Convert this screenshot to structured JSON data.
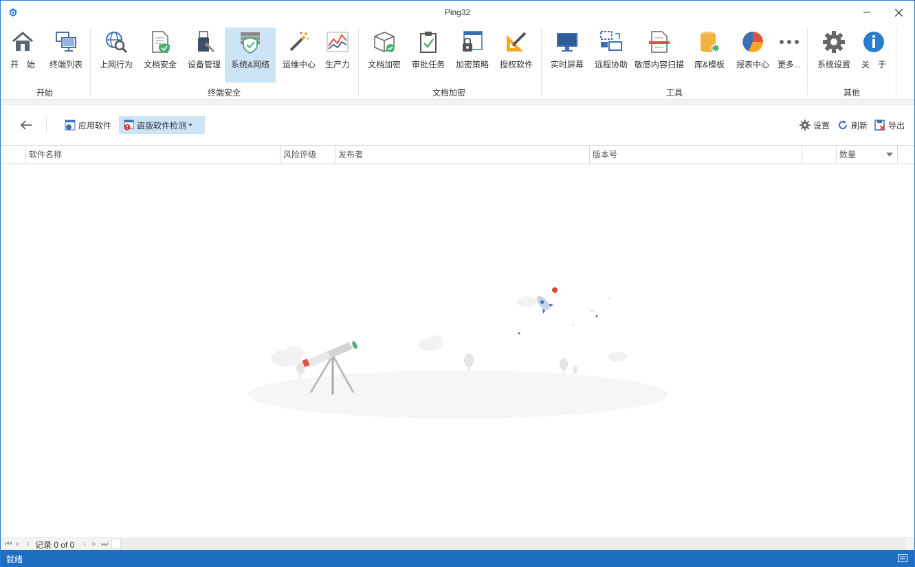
{
  "window": {
    "title": "Ping32"
  },
  "ribbon": {
    "buttons": [
      {
        "label": "开　始",
        "icon": "home-icon"
      },
      {
        "label": "终端列表",
        "icon": "terminal-list-icon"
      },
      {
        "label": "上网行为",
        "icon": "web-search-icon"
      },
      {
        "label": "文档安全",
        "icon": "document-shield-icon"
      },
      {
        "label": "设备管理",
        "icon": "usb-device-icon"
      },
      {
        "label": "系统&网络",
        "icon": "firewall-shield-icon"
      },
      {
        "label": "运维中心",
        "icon": "magic-wand-icon"
      },
      {
        "label": "生产力",
        "icon": "productivity-chart-icon"
      },
      {
        "label": "文档加密",
        "icon": "box-encrypt-icon"
      },
      {
        "label": "审批任务",
        "icon": "clipboard-check-icon"
      },
      {
        "label": "加密策略",
        "icon": "lock-window-icon"
      },
      {
        "label": "授权软件",
        "icon": "ruler-pencil-icon"
      },
      {
        "label": "实时屏幕",
        "icon": "monitor-icon"
      },
      {
        "label": "远程协助",
        "icon": "remote-desktop-icon"
      },
      {
        "label": "敏感内容扫描",
        "icon": "document-scan-icon"
      },
      {
        "label": "库&模板",
        "icon": "database-icon"
      },
      {
        "label": "报表中心",
        "icon": "pie-chart-icon"
      },
      {
        "label": "更多...",
        "icon": "more-dots-icon"
      },
      {
        "label": "系统设置",
        "icon": "gear-icon"
      },
      {
        "label": "关　于",
        "icon": "info-icon"
      }
    ],
    "groups": [
      "开始",
      "终端安全",
      "文档加密",
      "工具",
      "其他"
    ],
    "active": "系统&网络"
  },
  "toolbar": {
    "back_label": "",
    "app_software": "应用软件",
    "pirated_detect": "盗版软件检测",
    "settings": "设置",
    "refresh": "刷新",
    "export": "导出"
  },
  "grid": {
    "columns": [
      "软件名称",
      "风险评级",
      "发布者",
      "版本号",
      "",
      "数量"
    ],
    "rows": []
  },
  "pager": {
    "records": "记录 0 of 0"
  },
  "status": {
    "text": "就绪"
  },
  "colors": {
    "accent": "#1e6fc4",
    "active_bg": "#cde4f7"
  }
}
